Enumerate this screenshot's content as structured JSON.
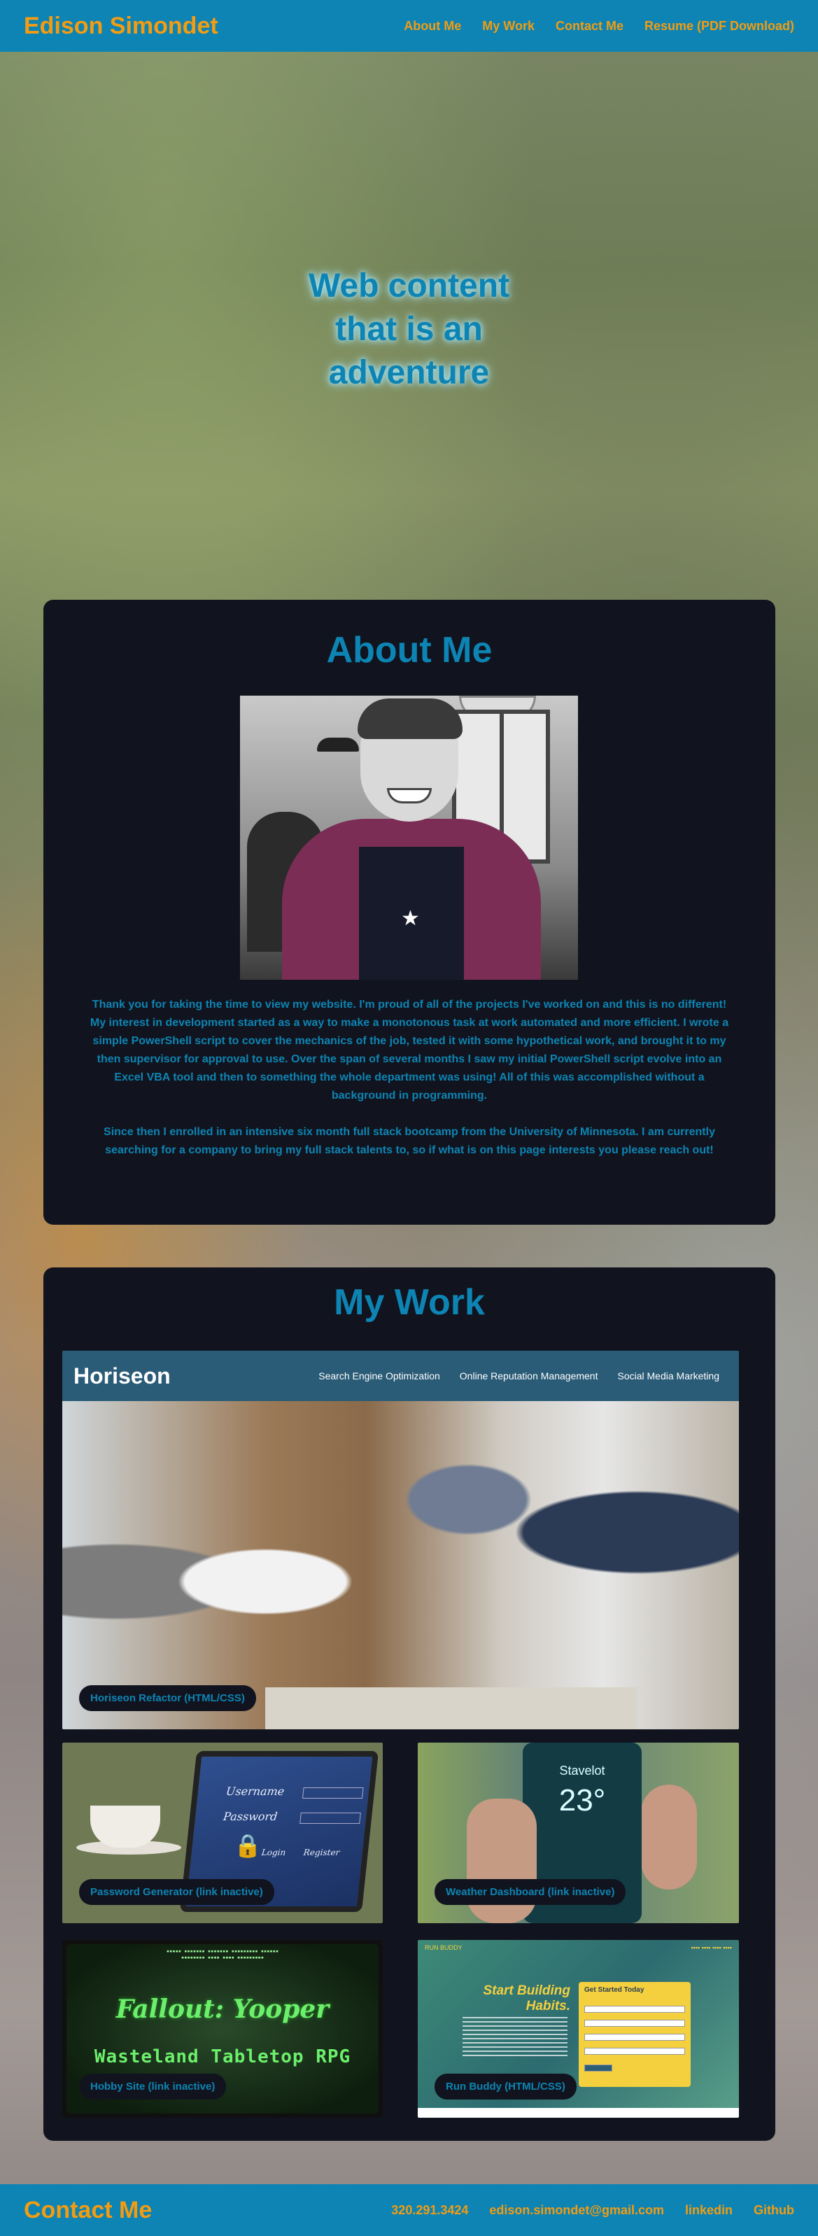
{
  "header": {
    "brand": "Edison Simondet",
    "nav": [
      "About Me",
      "My Work",
      "Contact Me",
      "Resume (PDF Download)"
    ]
  },
  "hero": {
    "lines": [
      "Web content",
      "that is an",
      "adventure"
    ]
  },
  "about": {
    "title": "About Me",
    "paragraphs": [
      "Thank you for taking the time to view my website. I'm proud of all of the projects I've worked on and this is no different! My interest in development started as a way to make a monotonous task at work automated and more efficient. I wrote a simple PowerShell script to cover the mechanics of the job, tested it with some hypothetical work, and brought it to my then supervisor for approval to use. Over the span of several months I saw my initial PowerShell script evolve into an Excel VBA tool and then to something the whole department was using! All of this was accomplished without a background in programming.",
      "Since then I enrolled in an intensive six month full stack bootcamp from the University of Minnesota. I am currently searching for a company to bring my full stack talents to, so if what is on this page interests you please reach out!"
    ]
  },
  "work": {
    "title": "My Work",
    "projects": [
      {
        "label": "Horiseon Refactor (HTML/CSS)"
      },
      {
        "label": "Password Generator (link inactive)"
      },
      {
        "label": "Weather Dashboard (link inactive)"
      },
      {
        "label": "Hobby Site (link inactive)"
      },
      {
        "label": "Run Buddy (HTML/CSS)"
      }
    ],
    "horiseon_preview": {
      "logo": "Horiseon",
      "nav": [
        "Search Engine Optimization",
        "Online Reputation Management",
        "Social Media Marketing"
      ]
    },
    "password_preview": {
      "username": "Username",
      "password": "Password",
      "login": "Login",
      "register": "Register"
    },
    "weather_preview": {
      "city": "Stavelot",
      "temp": "23°"
    },
    "hobby_preview": {
      "title": "Fallout: Yooper",
      "subtitle": "Wasteland Tabletop RPG"
    },
    "runbuddy_preview": {
      "brand": "RUN BUDDY",
      "headline": "Start Building Habits.",
      "form_title": "Get Started Today"
    }
  },
  "footer": {
    "title": "Contact Me",
    "links": [
      "320.291.3424",
      "edison.simondet@gmail.com",
      "linkedin",
      "Github"
    ]
  },
  "colors": {
    "header_bg": "#0d84b3",
    "accent_orange": "#f39c12",
    "panel_bg": "#11141e",
    "title_blue": "#0d84b3"
  }
}
